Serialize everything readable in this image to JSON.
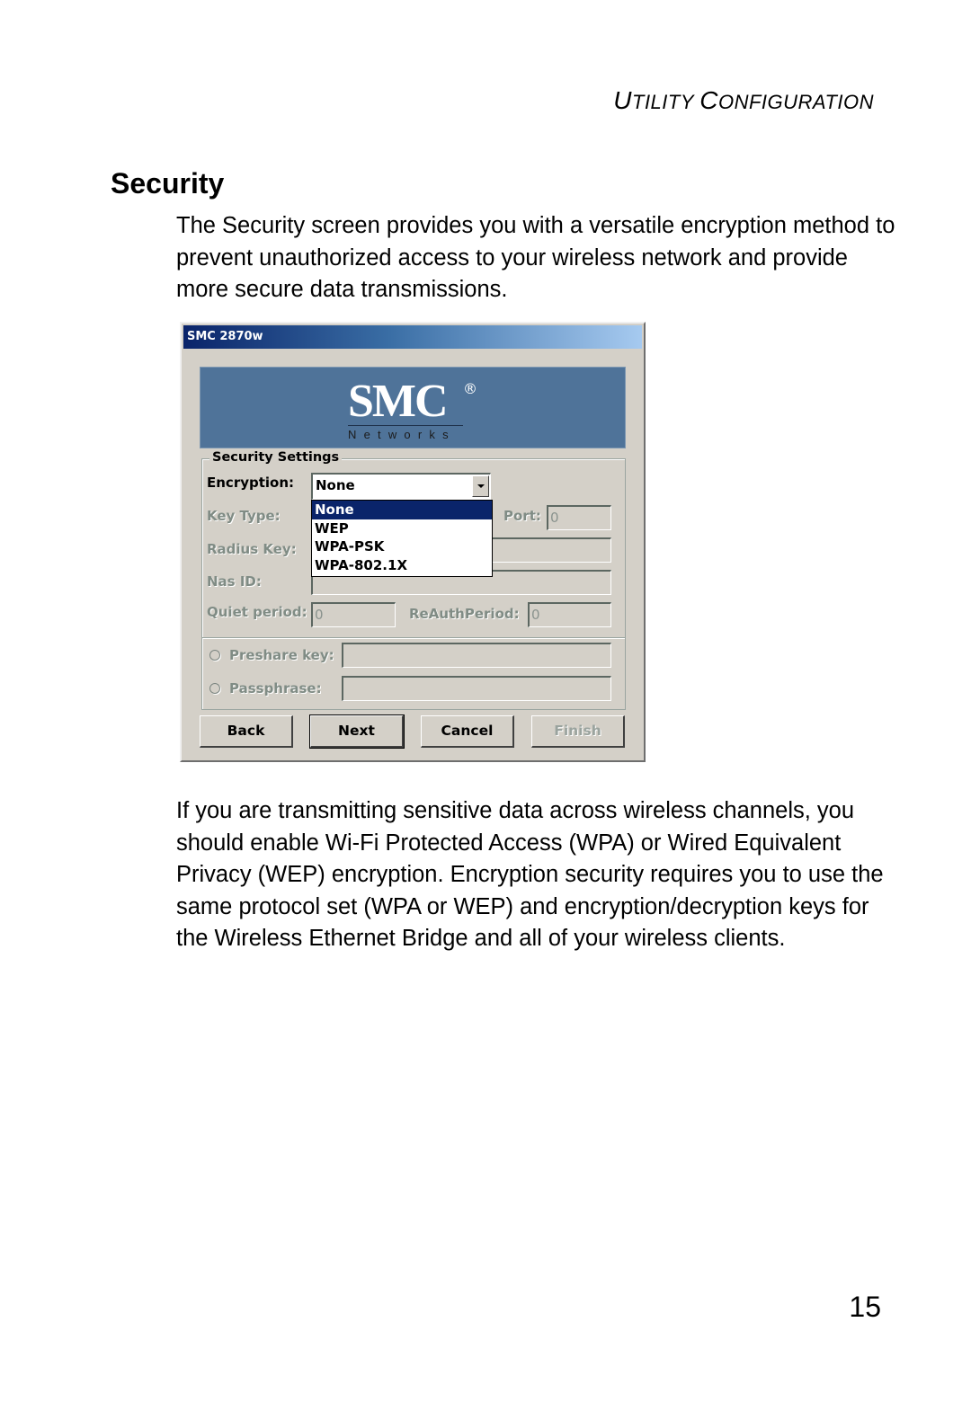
{
  "running_head": {
    "first_U": "U",
    "rest1": "TILITY ",
    "first_C": "C",
    "rest2": "ONFIGURATION"
  },
  "section_title": "Security",
  "intro_paragraph": "The Security screen provides you with a versatile encryption method to prevent unauthorized access to your wireless network and provide more secure data transmissions.",
  "dialog": {
    "title": "SMC 2870w",
    "logo": {
      "brand": "SMC",
      "registered": "®",
      "subtitle": "Networks"
    },
    "group_title": "Security Settings",
    "encryption": {
      "label": "Encryption:",
      "value": "None",
      "options": [
        "None",
        "WEP",
        "WPA-PSK",
        "WPA-802.1X"
      ],
      "highlighted_option": "None"
    },
    "fields": {
      "key_type_label": "Key Type:",
      "port_label": "Port:",
      "port_value": "0",
      "radius_key_label": "Radius Key:",
      "nas_id_label": "Nas ID:",
      "quiet_period_label": "Quiet period:",
      "quiet_period_value": "0",
      "reauth_period_label": "ReAuthPeriod:",
      "reauth_period_value": "0",
      "preshare_key_label": "Preshare key:",
      "passphrase_label": "Passphrase:"
    },
    "buttons": {
      "back": "Back",
      "next": "Next",
      "cancel": "Cancel",
      "finish": "Finish"
    }
  },
  "body_paragraph": "If you are transmitting sensitive data across wireless channels, you should enable Wi-Fi Protected Access (WPA) or Wired Equivalent Privacy (WEP) encryption. Encryption security requires you to use the same protocol set (WPA or WEP) and encryption/decryption keys for the Wireless Ethernet Bridge and all of your wireless clients.",
  "page_number": "15"
}
